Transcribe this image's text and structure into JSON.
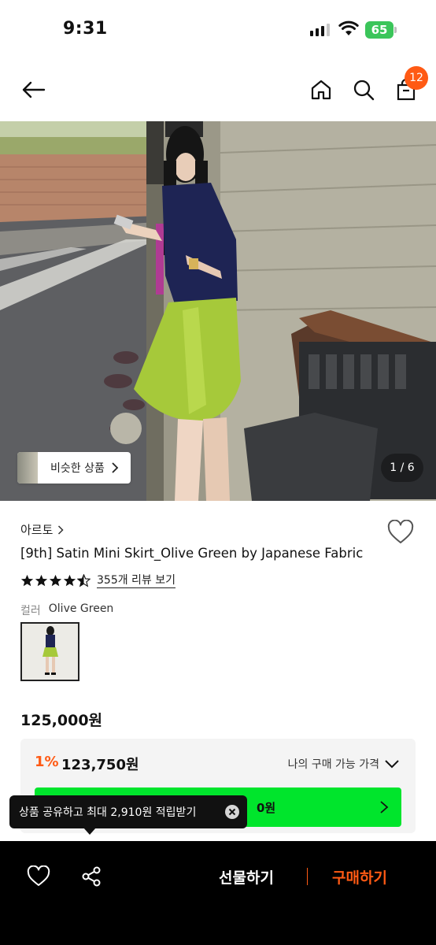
{
  "status_bar": {
    "time": "9:31",
    "battery": "65"
  },
  "header": {
    "cart_count": "12"
  },
  "hero": {
    "similar_label": "비슷한 상품",
    "page_indicator": "1 / 6"
  },
  "product": {
    "brand": "아르토",
    "title": "[9th] Satin Mini Skirt_Olive Green by Japanese Fabric",
    "rating": 4.5,
    "review_link": "355개 리뷰 보기",
    "color_label": "컬러",
    "color_value": "Olive Green",
    "price": "125,000원"
  },
  "price_box": {
    "discount_rate": "1%",
    "discount_price": "123,750원",
    "my_price_label": "나의 구매 가능 가격",
    "green_button_visible_text": "0원"
  },
  "tooltip": {
    "text": "상품 공유하고 최대 2,910원 적립받기"
  },
  "bottom_bar": {
    "gift_label": "선물하기",
    "buy_label": "구매하기"
  },
  "colors": {
    "accent": "#ff5a14",
    "green": "#00e52c",
    "skirt": "#a6c93a"
  }
}
